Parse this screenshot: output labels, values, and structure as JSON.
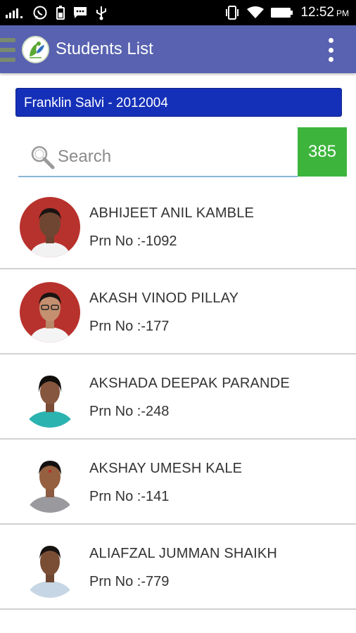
{
  "status_bar": {
    "time": "12:52",
    "ampm": "PM",
    "icons": [
      "signal-icon",
      "whatsapp-icon",
      "battery-saver-icon",
      "message-icon",
      "usb-icon",
      "vibrate-icon",
      "wifi-icon",
      "battery-icon"
    ]
  },
  "app_bar": {
    "title": "Students List",
    "icons": [
      "menu-icon",
      "app-logo-icon",
      "overflow-menu-icon"
    ]
  },
  "selector": {
    "value": "Franklin Salvi - 2012004"
  },
  "search": {
    "placeholder": "Search",
    "value": "",
    "count": "385"
  },
  "students": [
    {
      "name": "ABHIJEET ANIL KAMBLE",
      "prn": "Prn No :-1092"
    },
    {
      "name": "AKASH VINOD PILLAY",
      "prn": "Prn No :-177"
    },
    {
      "name": "AKSHADA DEEPAK PARANDE",
      "prn": "Prn No :-248"
    },
    {
      "name": "AKSHAY UMESH KALE",
      "prn": "Prn No :-141"
    },
    {
      "name": "ALIAFZAL JUMMAN SHAIKH",
      "prn": "Prn No :-779"
    }
  ],
  "colors": {
    "app_bar": "#5862b0",
    "selector": "#1530b8",
    "badge": "#3db53d",
    "search_underline": "#8ab6d6"
  }
}
